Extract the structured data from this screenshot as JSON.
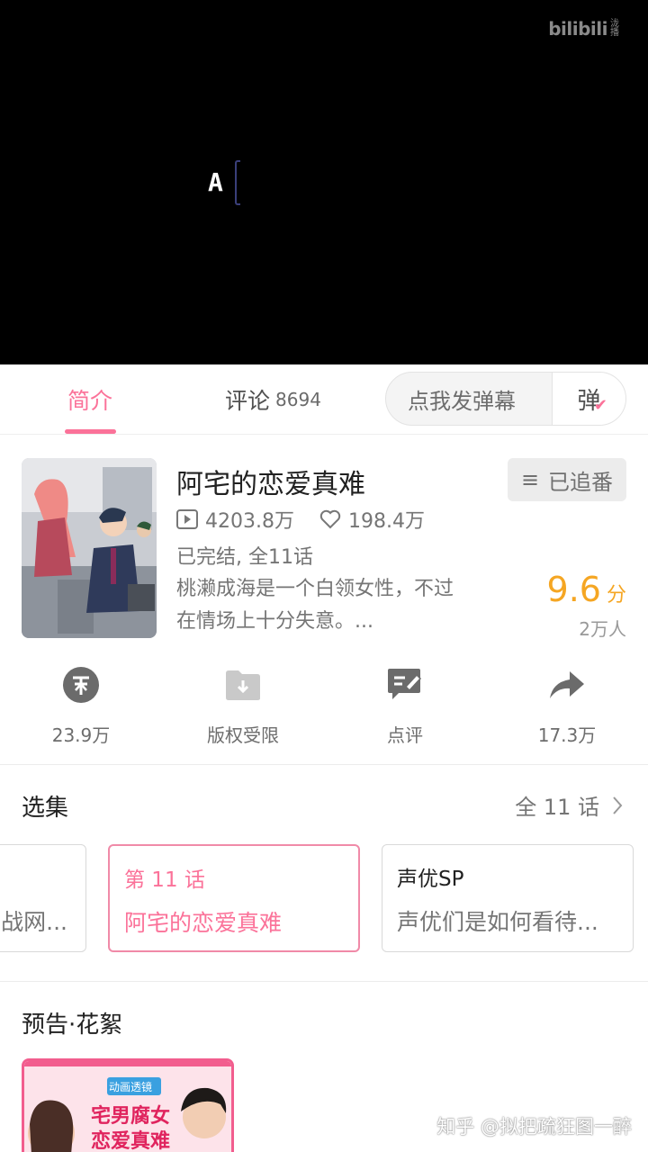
{
  "player": {
    "logo": "bilibili",
    "logo_sub": "泷播",
    "glyph": "A"
  },
  "tabs": {
    "intro": "简介",
    "comments": "评论",
    "comments_count": "8694",
    "danmaku_placeholder": "点我发弹幕",
    "danmaku_toggle": "弹"
  },
  "show": {
    "title": "阿宅的恋爱真难",
    "follow_label": "已追番",
    "views": "4203.8万",
    "likes": "198.4万",
    "status": "已完结, 全11话",
    "description_line1": "桃濑成海是一个白领女性，不过",
    "description_line2": "在情场上十分失意。...",
    "score": "9.6",
    "score_unit": "分",
    "raters": "2万人"
  },
  "actions": [
    {
      "icon": "coin-icon",
      "label": "23.9万"
    },
    {
      "icon": "download-folder-icon",
      "label": "版权受限"
    },
    {
      "icon": "review-icon",
      "label": "点评"
    },
    {
      "icon": "share-icon",
      "label": "17.3万"
    }
  ],
  "episodes": {
    "title": "选集",
    "all_label": "全 11 话",
    "items": [
      {
        "line1": "",
        "line2": "战网..."
      },
      {
        "line1": "第 11 话",
        "line2": "阿宅的恋爱真难"
      },
      {
        "line1": "声优SP",
        "line2": "声优们是如何看待..."
      }
    ]
  },
  "trailers": {
    "title": "预告·花絮",
    "thumb_text1": "动画透镜",
    "thumb_text2": "宅男腐女",
    "thumb_text3": "恋爱真难"
  },
  "watermark": "知乎 @拟把疏狂图一醉",
  "colors": {
    "accent": "#fb7299",
    "score": "#f5a623"
  }
}
